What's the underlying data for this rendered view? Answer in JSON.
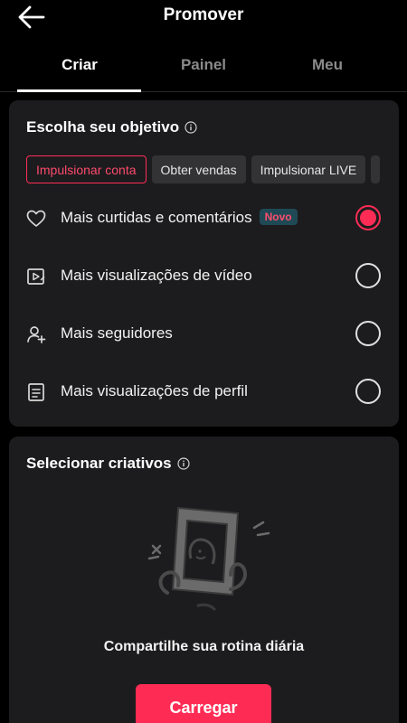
{
  "header": {
    "title": "Promover",
    "back_icon": "arrow-left-icon"
  },
  "tabs": [
    {
      "label": "Criar",
      "active": true
    },
    {
      "label": "Painel",
      "active": false
    },
    {
      "label": "Meu",
      "active": false
    }
  ],
  "objective": {
    "title": "Escolha seu objetivo",
    "chips": [
      {
        "label": "Impulsionar conta",
        "active": true
      },
      {
        "label": "Obter vendas",
        "active": false
      },
      {
        "label": "Impulsionar LIVE",
        "active": false
      }
    ],
    "options": [
      {
        "label": "Mais curtidas e comentários",
        "badge": "Novo",
        "icon": "heart-icon",
        "selected": true
      },
      {
        "label": "Mais visualizações de vídeo",
        "icon": "video-play-icon",
        "selected": false
      },
      {
        "label": "Mais seguidores",
        "icon": "add-user-icon",
        "selected": false
      },
      {
        "label": "Mais visualizações de perfil",
        "icon": "document-icon",
        "selected": false
      }
    ]
  },
  "creatives": {
    "title": "Selecionar criativos",
    "empty_text": "Compartilhe sua rotina diária",
    "upload_label": "Carregar"
  },
  "colors": {
    "accent": "#fe2c55",
    "card": "#1c1c1e",
    "background": "#000000",
    "badge_bg": "#1f4a55"
  }
}
